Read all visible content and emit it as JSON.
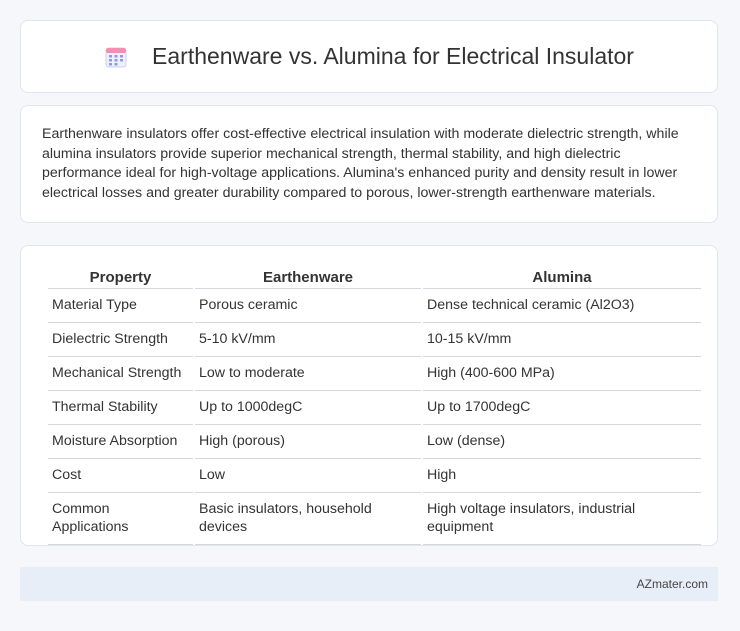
{
  "header": {
    "title": "Earthenware vs. Alumina for Electrical Insulator",
    "icon": "calendar-icon"
  },
  "summary": "Earthenware insulators offer cost-effective electrical insulation with moderate dielectric strength, while alumina insulators provide superior mechanical strength, thermal stability, and high dielectric performance ideal for high-voltage applications. Alumina's enhanced purity and density result in lower electrical losses and greater durability compared to porous, lower-strength earthenware materials.",
  "table": {
    "headers": [
      "Property",
      "Earthenware",
      "Alumina"
    ],
    "rows": [
      [
        "Material Type",
        "Porous ceramic",
        "Dense technical ceramic (Al2O3)"
      ],
      [
        "Dielectric Strength",
        "5-10 kV/mm",
        "10-15 kV/mm"
      ],
      [
        "Mechanical Strength",
        "Low to moderate",
        "High (400-600 MPa)"
      ],
      [
        "Thermal Stability",
        "Up to 1000degC",
        "Up to 1700degC"
      ],
      [
        "Moisture Absorption",
        "High (porous)",
        "Low (dense)"
      ],
      [
        "Cost",
        "Low",
        "High"
      ],
      [
        "Common Applications",
        "Basic insulators, household devices",
        "High voltage insulators, industrial equipment"
      ]
    ]
  },
  "footer": {
    "brand": "AZmater.com"
  }
}
